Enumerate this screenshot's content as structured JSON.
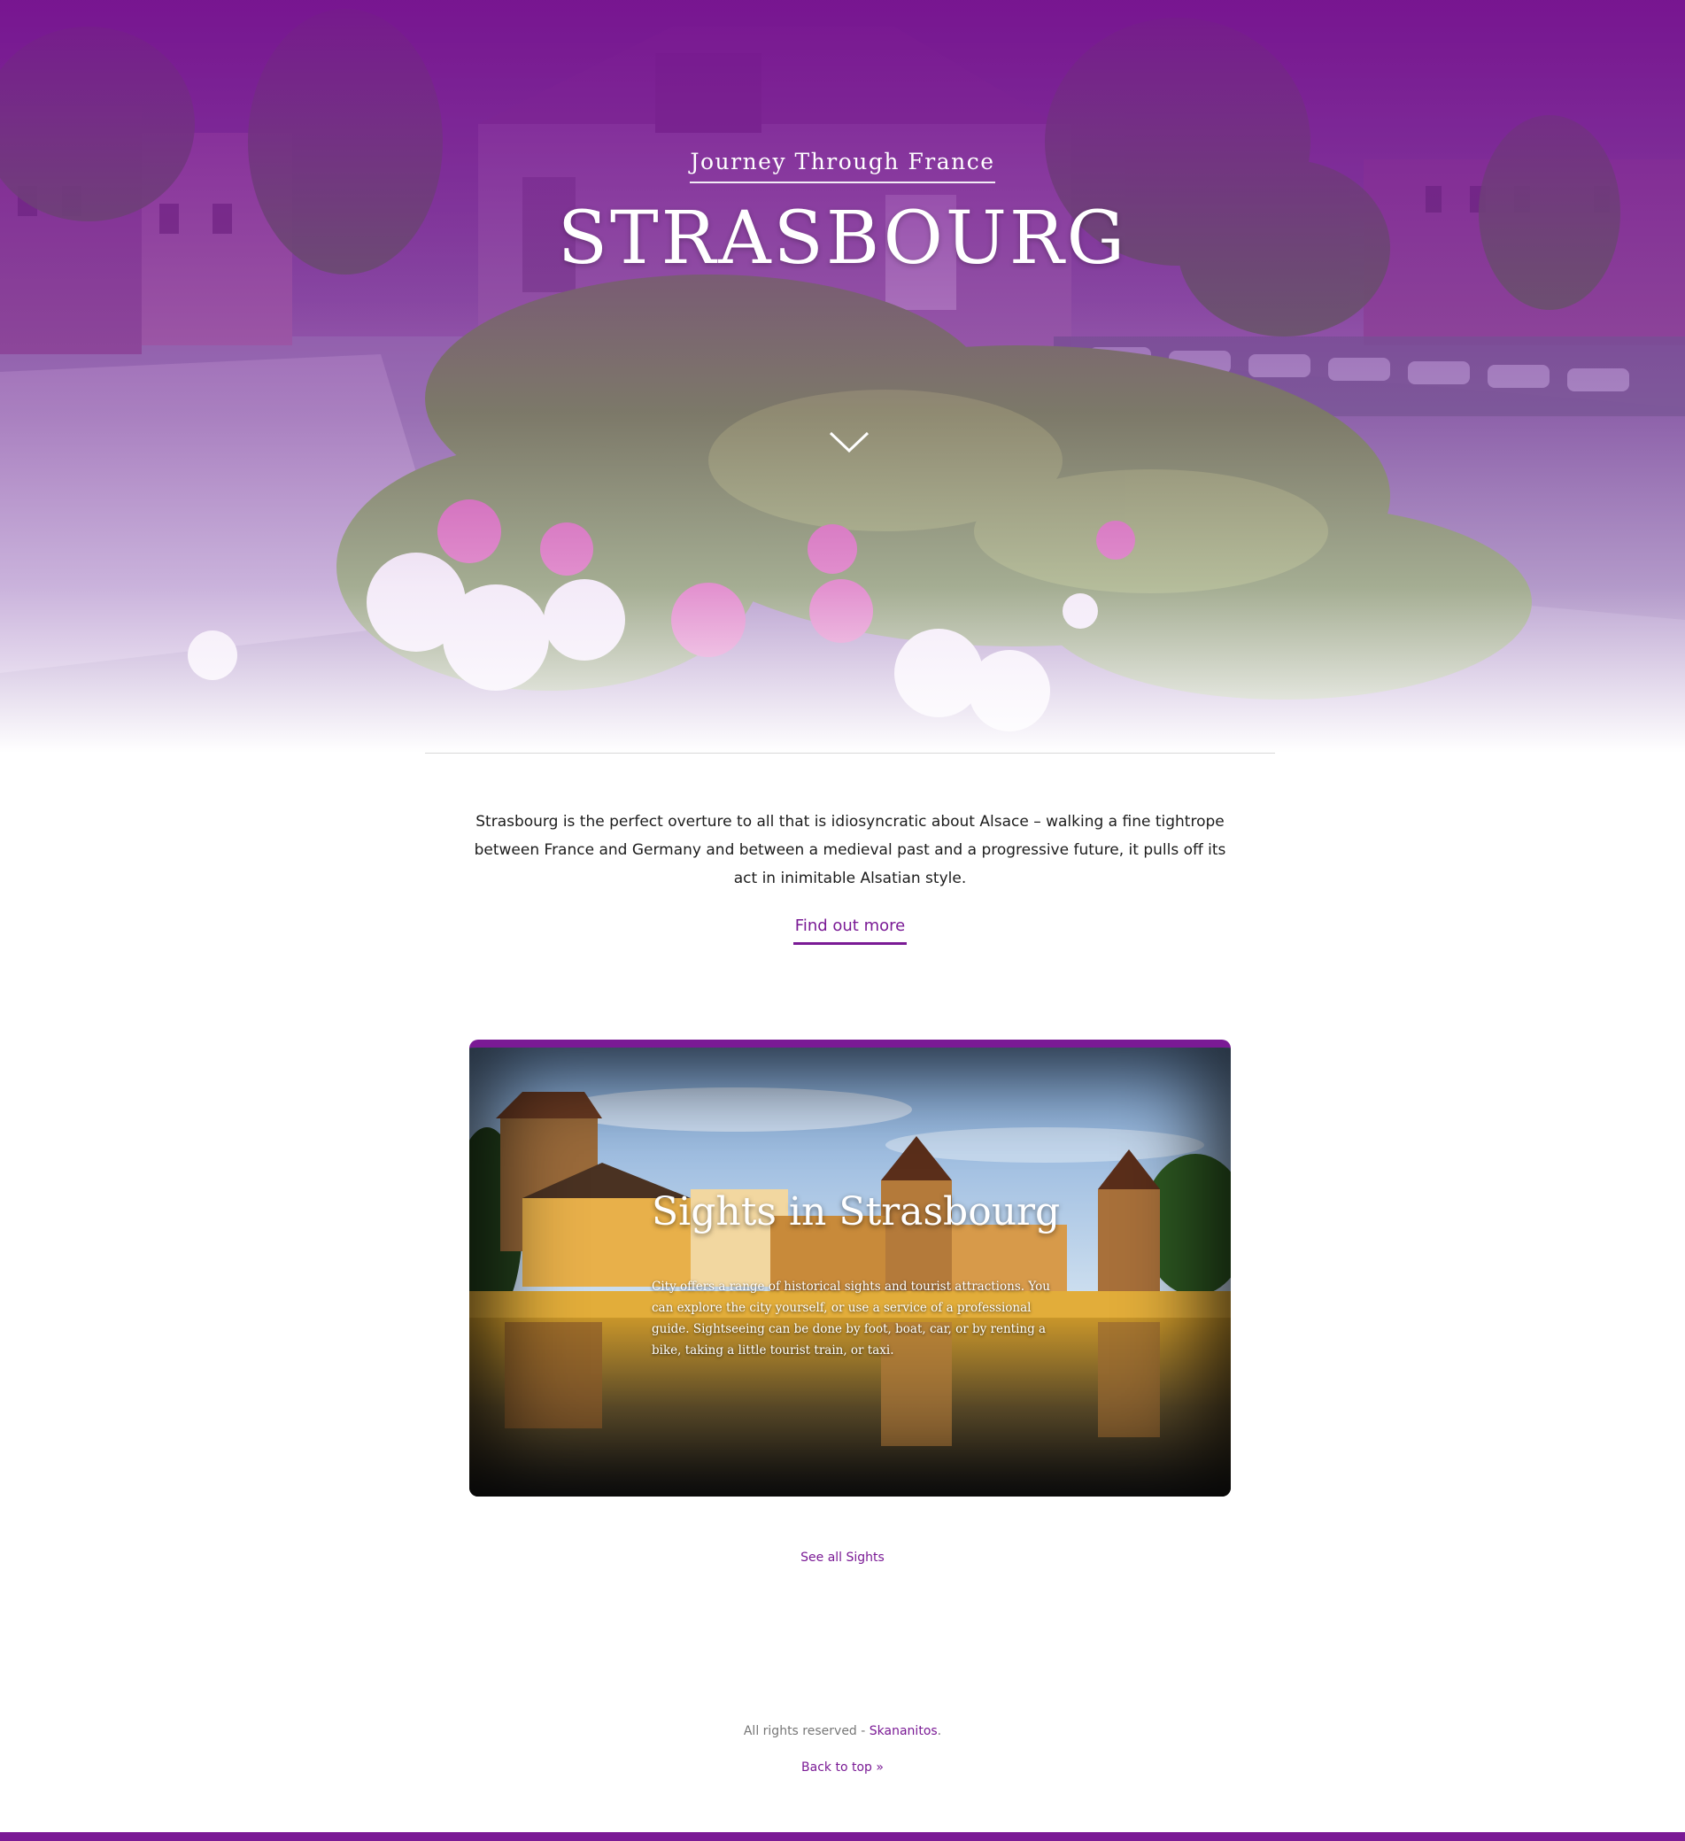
{
  "colors": {
    "brand": "#7a1a95",
    "text": "#1c1c1c",
    "muted": "#777777"
  },
  "hero": {
    "kicker": "Journey Through France",
    "title": "STRASBOURG",
    "scroll_icon": "chevron-down-icon"
  },
  "intro": {
    "text": "Strasbourg is the perfect overture to all that is idiosyncratic about Alsace – walking a fine tightrope between France and Germany and between a medieval past and a progressive future, it pulls off its act in inimitable Alsatian style.",
    "cta_label": "Find out more"
  },
  "card": {
    "title": "Sights in Strasbourg",
    "text": "City offers a range of historical sights and tourist attractions. You can explore the city yourself, or use a service of a professional guide. Sightseeing can be done by foot, boat, car, or by renting a bike, taking a little tourist train, or taxi."
  },
  "see_all_label": "See all Sights",
  "footer": {
    "rights_text": "All rights reserved - ",
    "brand_link": "Skananitos",
    "brand_suffix": ".",
    "back_to_top": "Back to top »"
  }
}
